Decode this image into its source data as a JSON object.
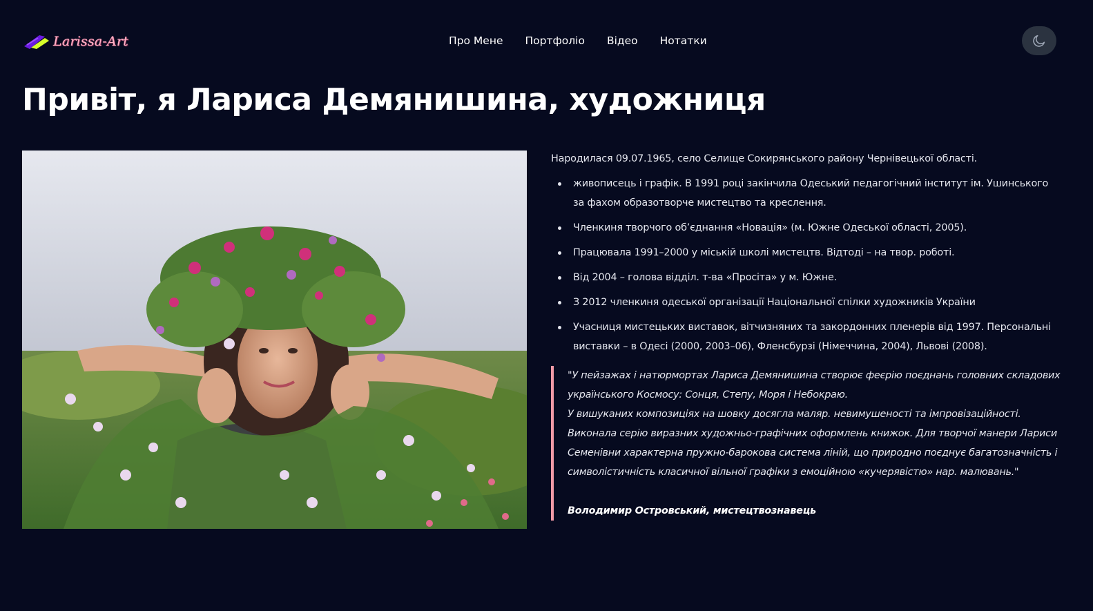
{
  "header": {
    "logo_text": "Larissa-Art",
    "nav": [
      "Про Мене",
      "Портфоліо",
      "Відео",
      "Нотатки"
    ],
    "theme_icon": "moon-icon"
  },
  "hero": {
    "title": "Привіт, я Лариса Демянишина, художниця"
  },
  "photo": {
    "icon": "portrait-photo"
  },
  "bio": {
    "born": "Народилася 09.07.1965, село Селище Сокирянського району Чернівецької області.",
    "facts": [
      "живописець і графік. В 1991 році закінчила Одеський педагогічний інститут ім. Ушинського за фахом образотворче мистецтво та креслення.",
      "Членкиня творчого об’єднання «Новація» (м. Южне Одеської області, 2005).",
      "Працювала 1991–2000 у міській школі мистецтв. Відтоді – на твор. роботі.",
      "Від 2004 – голова відділ. т-ва «Просіта» у м. Южне.",
      "З 2012 членкиня одеської організації Національної спілки художників України",
      "Учасниця мистецьких виставок, вітчизняних та закордонних пленерів від 1997. Персональні виставки – в Одесі (2000, 2003–06), Фленсбурзі (Німеччина, 2004), Львові (2008)."
    ]
  },
  "quote": {
    "lines": [
      "\"У пейзажах і натюрмортах Лариса Демянишина створює феєрію поєднань головних складових українського Космосу: Сонця, Степу, Моря і Небокраю.",
      "У вишуканих композиціях на шовку досягла маляр. невимушеності та імпровізаційності.",
      "Виконала серію виразних художньо-графічних оформлень книжок. Для творчої манери Лариси Семенівни характерна пружно-барокова система ліній, що природно поєднує багатозначність і символістичність класичної вільної графіки з емоційною «кучерявістю» нар. малювань.\""
    ],
    "author": "Володимир Островський, мистецтвознавець"
  },
  "colors": {
    "background": "#060a1f",
    "text": "#e4e6ee",
    "quote_border": "#f09aa6",
    "toggle_bg": "#2b3340"
  }
}
